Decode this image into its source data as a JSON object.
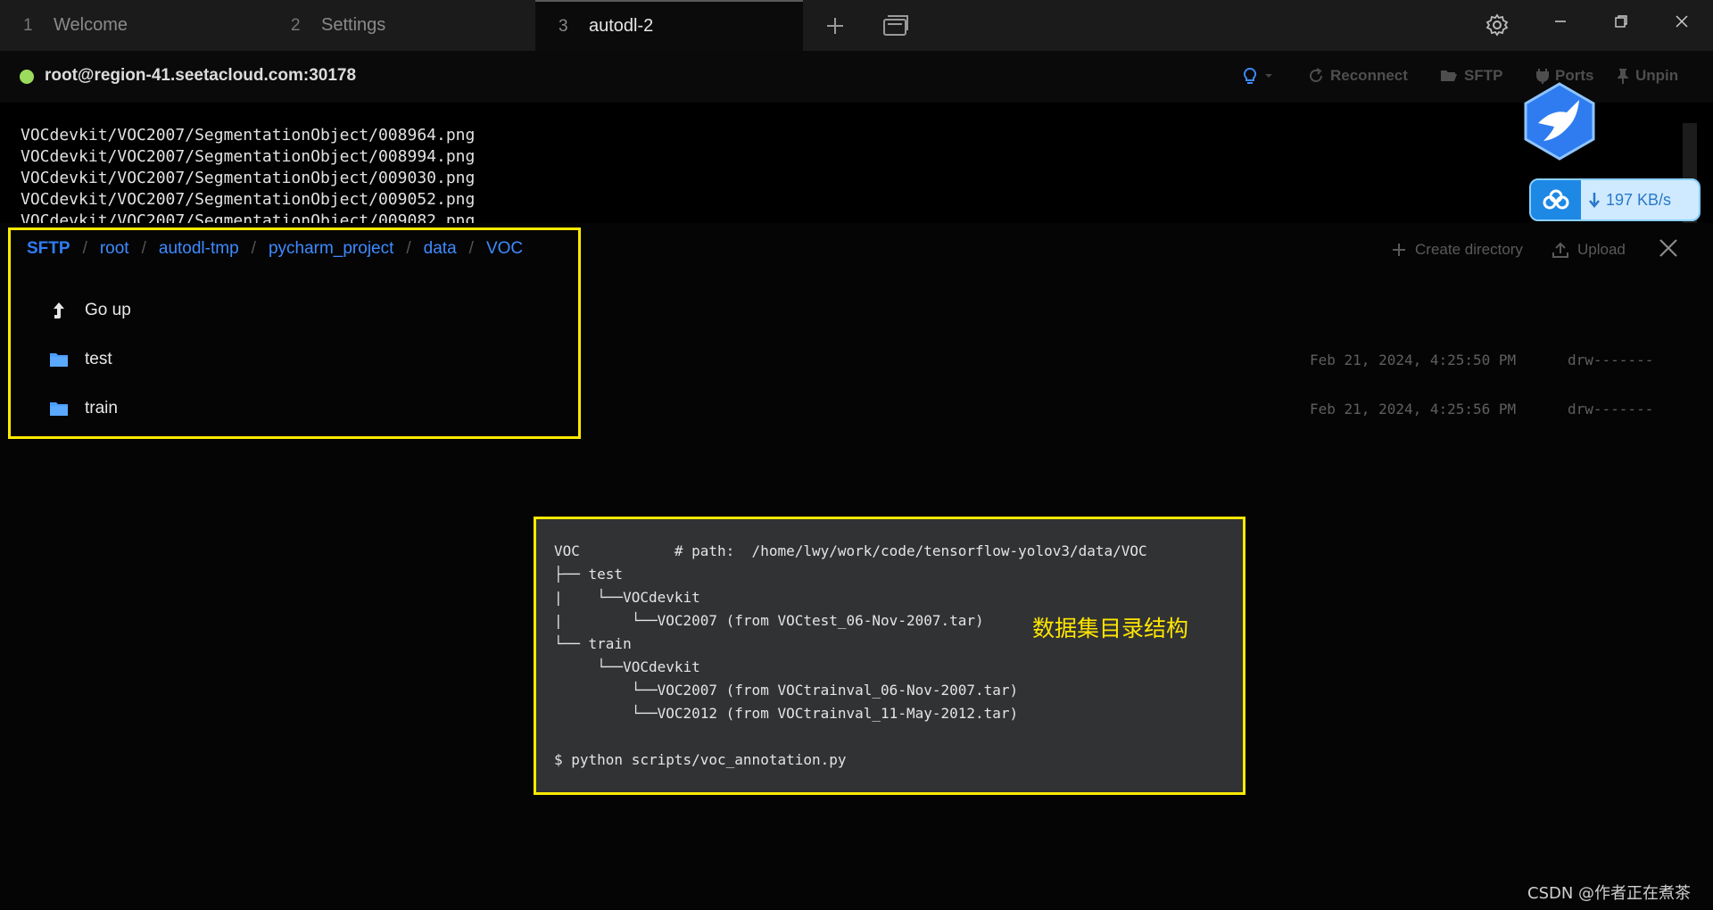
{
  "tabs": [
    {
      "num": "1",
      "label": "Welcome"
    },
    {
      "num": "2",
      "label": "Settings"
    },
    {
      "num": "3",
      "label": "autodl-2"
    }
  ],
  "icons": {
    "new_tab": "plus-icon",
    "tab_overview": "windows-icon",
    "settings": "gear-icon",
    "minimize": "minimize-icon",
    "restore": "restore-icon",
    "close": "close-icon"
  },
  "terminal": {
    "connection": "root@region-41.seetacloud.com:30178",
    "status_color": "#9bdc5c",
    "actions": {
      "reconnect": "Reconnect",
      "sftp": "SFTP",
      "ports": "Ports",
      "unpin": "Unpin"
    },
    "output_lines": [
      "VOCdevkit/VOC2007/SegmentationObject/008964.png",
      "VOCdevkit/VOC2007/SegmentationObject/008994.png",
      "VOCdevkit/VOC2007/SegmentationObject/009030.png",
      "VOCdevkit/VOC2007/SegmentationObject/009052.png",
      "VOCdevkit/VOC2007/SegmentationObject/009082.png"
    ]
  },
  "speed_widget": {
    "value": "197 KB/s"
  },
  "sftp": {
    "breadcrumbs": [
      "SFTP",
      "root",
      "autodl-tmp",
      "pycharm_project",
      "data",
      "VOC"
    ],
    "create_directory": "Create directory",
    "upload": "Upload",
    "go_up": "Go up",
    "entries": [
      {
        "name": "test",
        "date": "Feb 21, 2024, 4:25:50 PM",
        "perm": "drw-------"
      },
      {
        "name": "train",
        "date": "Feb 21, 2024, 4:25:56 PM",
        "perm": "drw-------"
      }
    ]
  },
  "annotation": {
    "tree_lines": [
      "VOC           # path:  /home/lwy/work/code/tensorflow-yolov3/data/VOC",
      "├── test",
      "|    └──VOCdevkit",
      "|        └──VOC2007 (from VOCtest_06-Nov-2007.tar)",
      "└── train",
      "     └──VOCdevkit",
      "         └──VOC2007 (from VOCtrainval_06-Nov-2007.tar)",
      "         └──VOC2012 (from VOCtrainval_11-May-2012.tar)",
      "",
      "$ python scripts/voc_annotation.py"
    ],
    "label": "数据集目录结构",
    "highlight_color": "#ffea00"
  },
  "watermark": "CSDN @作者正在煮茶"
}
